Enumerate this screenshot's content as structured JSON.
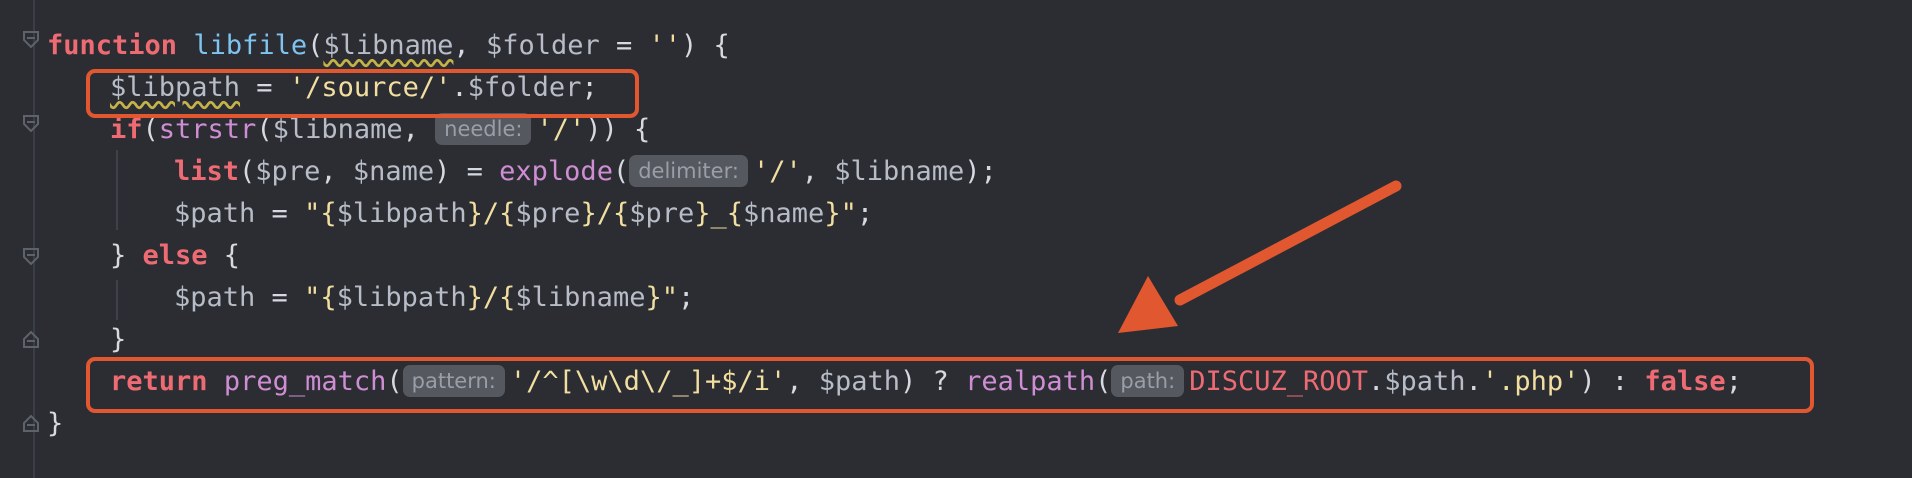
{
  "hints": {
    "needle": "needle:",
    "delimiter": "delimiter:",
    "pattern": "pattern:",
    "path": "path:"
  },
  "code": {
    "l1": {
      "kw_function": "function",
      "name": "libfile",
      "open": "(",
      "var_libname": "$libname",
      "sep": ", ",
      "var_folder": "$folder",
      "eq": " = ",
      "str_empty": "''",
      "close": ") {"
    },
    "l2": {
      "var_libpath": "$libpath",
      "eq": " = ",
      "str_source": "'/source/'",
      "dot": ".",
      "var_folder": "$folder",
      "semi": ";"
    },
    "l3": {
      "kw_if": "if",
      "open": "(",
      "fn_strstr": "strstr",
      "open2": "(",
      "var_libname": "$libname",
      "sep": ", ",
      "str_slash": "'/'",
      "close": ")) {"
    },
    "l4": {
      "kw_list": "list",
      "open": "(",
      "var_pre": "$pre",
      "sep": ", ",
      "var_name": "$name",
      "close_eq": ") = ",
      "fn_explode": "explode",
      "open2": "(",
      "str_slash": "'/'",
      "sep2": ", ",
      "var_libname": "$libname",
      "close2": ");"
    },
    "l5": {
      "var_path": "$path",
      "eq": " = ",
      "q1": "\"{",
      "v1": "$libpath",
      "s1": "}/{",
      "v2": "$pre",
      "s2": "}/{",
      "v3": "$pre",
      "s3": "}_{",
      "v4": "$name",
      "q2": "}\"",
      "semi": ";"
    },
    "l6": {
      "brace": "} ",
      "kw_else": "else",
      "open": " {"
    },
    "l7": {
      "var_path": "$path",
      "eq": " = ",
      "q1": "\"{",
      "v1": "$libpath",
      "s1": "}/{",
      "v2": "$libname",
      "q2": "}\"",
      "semi": ";"
    },
    "l8": {
      "brace": "}"
    },
    "l9": {
      "kw_return": "return",
      "fn_preg": "preg_match",
      "open": "(",
      "str_regex": "'/^[\\w\\d\\/_]+$/i'",
      "sep": ", ",
      "var_path": "$path",
      "close_q": ") ? ",
      "fn_realpath": "realpath",
      "open2": "(",
      "const_root": "DISCUZ_ROOT",
      "dot": ".",
      "var_path2": "$path",
      "dot2": ".",
      "str_php": "'.php'",
      "close_colon": ") : ",
      "kw_false": "false",
      "semi": ";"
    },
    "l10": {
      "brace": "}"
    }
  },
  "colors": {
    "background": "#2b2d33",
    "highlight_box": "#e1572f",
    "arrow": "#e1572f",
    "keyword": "#ef6b73",
    "function": "#cf8ed3",
    "string": "#f2dfa0",
    "variable": "#b7bcc6"
  },
  "icons": {
    "fold_open": "fold-open-icon",
    "fold_close": "fold-close-icon",
    "arrow": "pointer-arrow-annotation"
  }
}
